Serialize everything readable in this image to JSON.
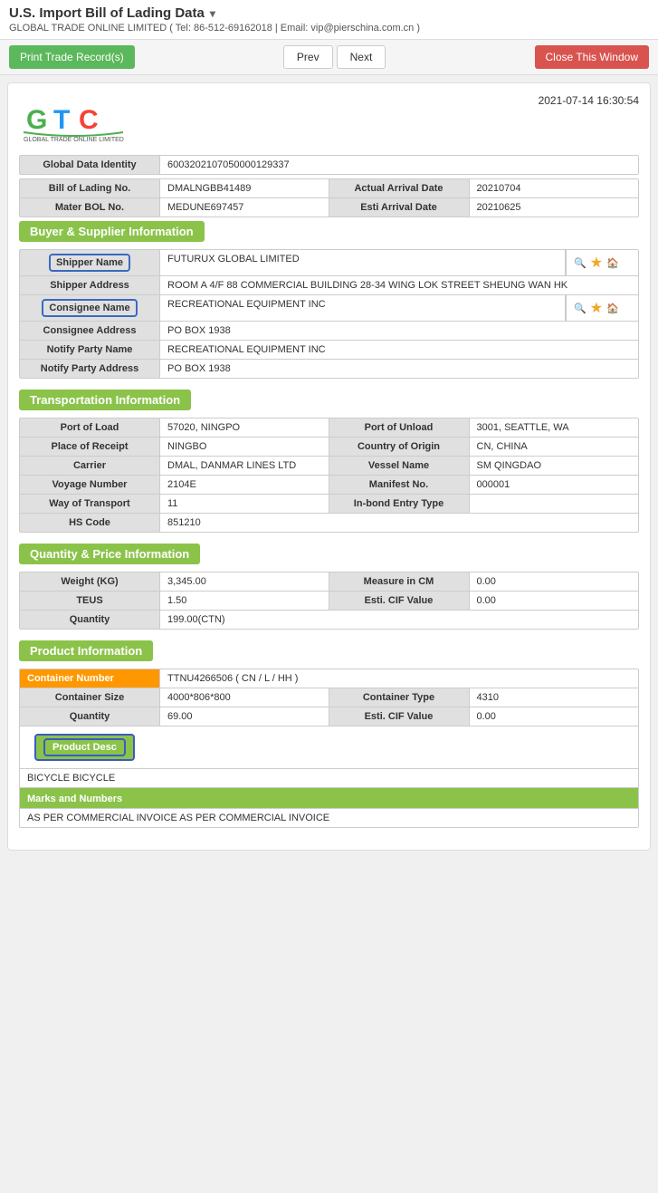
{
  "header": {
    "title": "U.S. Import Bill of Lading Data",
    "arrow": "▾",
    "company": "GLOBAL TRADE ONLINE LIMITED ( Tel: 86-512-69162018 | Email: vip@pierschina.com.cn )"
  },
  "toolbar": {
    "print_label": "Print Trade Record(s)",
    "prev_label": "Prev",
    "next_label": "Next",
    "close_label": "Close This Window"
  },
  "doc": {
    "timestamp": "2021-07-14 16:30:54",
    "global_id_label": "Global Data Identity",
    "global_id_value": "600320210705000012933 7",
    "bol_no_label": "Bill of Lading No.",
    "bol_no_value": "DMALNGBB41489",
    "arrival_date_label": "Actual Arrival Date",
    "arrival_date_value": "20210704",
    "mater_bol_label": "Mater BOL No.",
    "mater_bol_value": "MEDUNE697457",
    "esti_arrival_label": "Esti Arrival Date",
    "esti_arrival_value": "20210625"
  },
  "buyer_supplier": {
    "section_label": "Buyer & Supplier Information",
    "shipper_name_label": "Shipper Name",
    "shipper_name_value": "FUTURUX GLOBAL LIMITED",
    "shipper_address_label": "Shipper Address",
    "shipper_address_value": "ROOM A 4/F 88 COMMERCIAL BUILDING 28-34 WING LOK STREET SHEUNG WAN HK",
    "consignee_name_label": "Consignee Name",
    "consignee_name_value": "RECREATIONAL EQUIPMENT INC",
    "consignee_address_label": "Consignee Address",
    "consignee_address_value": "PO BOX 1938",
    "notify_party_name_label": "Notify Party Name",
    "notify_party_name_value": "RECREATIONAL EQUIPMENT INC",
    "notify_party_address_label": "Notify Party Address",
    "notify_party_address_value": "PO BOX 1938"
  },
  "transportation": {
    "section_label": "Transportation Information",
    "port_of_load_label": "Port of Load",
    "port_of_load_value": "57020, NINGPO",
    "port_of_unload_label": "Port of Unload",
    "port_of_unload_value": "3001, SEATTLE, WA",
    "place_of_receipt_label": "Place of Receipt",
    "place_of_receipt_value": "NINGBO",
    "country_of_origin_label": "Country of Origin",
    "country_of_origin_value": "CN, CHINA",
    "carrier_label": "Carrier",
    "carrier_value": "DMAL, DANMAR LINES LTD",
    "vessel_name_label": "Vessel Name",
    "vessel_name_value": "SM QINGDAO",
    "voyage_number_label": "Voyage Number",
    "voyage_number_value": "2104E",
    "manifest_no_label": "Manifest No.",
    "manifest_no_value": "000001",
    "way_of_transport_label": "Way of Transport",
    "way_of_transport_value": "11",
    "inbond_entry_label": "In-bond Entry Type",
    "inbond_entry_value": "",
    "hs_code_label": "HS Code",
    "hs_code_value": "851210"
  },
  "quantity_price": {
    "section_label": "Quantity & Price Information",
    "weight_label": "Weight (KG)",
    "weight_value": "3,345.00",
    "measure_label": "Measure in CM",
    "measure_value": "0.00",
    "teus_label": "TEUS",
    "teus_value": "1.50",
    "esti_cif_label": "Esti. CIF Value",
    "esti_cif_value": "0.00",
    "quantity_label": "Quantity",
    "quantity_value": "199.00(CTN)"
  },
  "product": {
    "section_label": "Product Information",
    "container_number_label": "Container Number",
    "container_number_value": "TTNU4266506 ( CN / L / HH )",
    "container_size_label": "Container Size",
    "container_size_value": "4000*806*800",
    "container_type_label": "Container Type",
    "container_type_value": "4310",
    "quantity_label": "Quantity",
    "quantity_value": "69.00",
    "esti_cif_label": "Esti. CIF Value",
    "esti_cif_value": "0.00",
    "product_desc_label": "Product Desc",
    "product_desc_value": "BICYCLE BICYCLE",
    "marks_label": "Marks and Numbers",
    "marks_value": "AS PER COMMERCIAL INVOICE AS PER COMMERCIAL INVOICE"
  },
  "icons": {
    "search": "🔍",
    "star": "★",
    "home": "🏠",
    "dropdown": "▾"
  }
}
